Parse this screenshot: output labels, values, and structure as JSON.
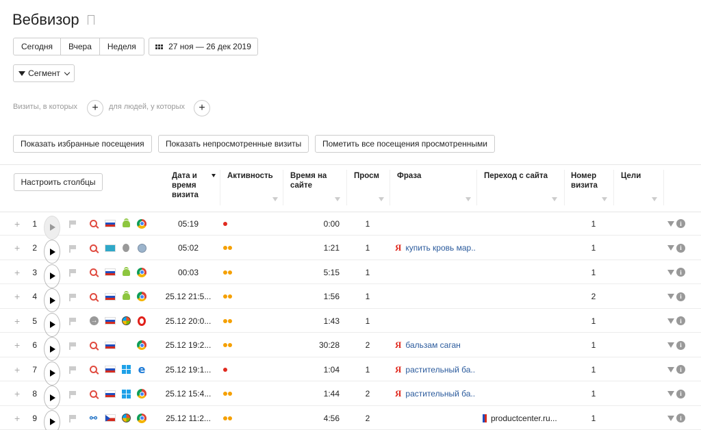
{
  "page": {
    "title": "Вебвизор"
  },
  "period": {
    "today": "Сегодня",
    "yesterday": "Вчера",
    "week": "Неделя",
    "date_range": "27 ноя — 26 дек 2019"
  },
  "segment": {
    "label": "Сегмент"
  },
  "conditions": {
    "visits_label": "Визиты, в которых",
    "people_label": "для людей, у которых"
  },
  "actions": {
    "show_favorites": "Показать избранные посещения",
    "show_unviewed": "Показать непросмотренные визиты",
    "mark_all_viewed": "Пометить все посещения просмотренными"
  },
  "table": {
    "configure_columns": "Настроить столбцы",
    "headers": {
      "datetime": "Дата и время визита",
      "activity": "Активность",
      "time_on_site": "Время на сайте",
      "views": "Просм",
      "phrase": "Фраза",
      "referrer": "Переход с сайта",
      "visit_number": "Номер визита",
      "goals": "Цели"
    },
    "rows": [
      {
        "n": "1",
        "src": "search",
        "country": "ru",
        "os": "android",
        "browser": "chrome",
        "date": "05:19",
        "activity": "red",
        "duration": "0:00",
        "views": "1",
        "phrase": "",
        "referrer": "",
        "visit": "1"
      },
      {
        "n": "2",
        "src": "search",
        "country": "kz",
        "os": "apple",
        "browser": "safari",
        "date": "05:02",
        "activity": "yellow2",
        "duration": "1:21",
        "views": "1",
        "phrase": "купить кровь мар...",
        "referrer": "",
        "visit": "1"
      },
      {
        "n": "3",
        "src": "search",
        "country": "ru",
        "os": "android",
        "browser": "chrome",
        "date": "00:03",
        "activity": "yellow2",
        "duration": "5:15",
        "views": "1",
        "phrase": "",
        "referrer": "",
        "visit": "1"
      },
      {
        "n": "4",
        "src": "search",
        "country": "ru",
        "os": "android",
        "browser": "chrome",
        "date": "25.12 21:5...",
        "activity": "yellow2",
        "duration": "1:56",
        "views": "1",
        "phrase": "",
        "referrer": "",
        "visit": "2"
      },
      {
        "n": "5",
        "src": "direct",
        "country": "ru",
        "os": "win7",
        "browser": "opera",
        "date": "25.12 20:0...",
        "activity": "yellow2",
        "duration": "1:43",
        "views": "1",
        "phrase": "",
        "referrer": "",
        "visit": "1"
      },
      {
        "n": "6",
        "src": "search",
        "country": "ru",
        "os": "",
        "browser": "chrome",
        "date": "25.12 19:2...",
        "activity": "yellow2",
        "duration": "30:28",
        "views": "2",
        "phrase": "бальзам саган",
        "referrer": "",
        "visit": "1"
      },
      {
        "n": "7",
        "src": "search",
        "country": "ru",
        "os": "windows",
        "browser": "edge",
        "date": "25.12 19:1...",
        "activity": "red",
        "duration": "1:04",
        "views": "1",
        "phrase": "растительный ба...",
        "referrer": "",
        "visit": "1"
      },
      {
        "n": "8",
        "src": "search",
        "country": "ru",
        "os": "windows",
        "browser": "chrome",
        "date": "25.12 15:4...",
        "activity": "yellow2",
        "duration": "1:44",
        "views": "2",
        "phrase": "растительный ба...",
        "referrer": "",
        "visit": "1"
      },
      {
        "n": "9",
        "src": "link",
        "country": "cz",
        "os": "win7",
        "browser": "chrome",
        "date": "25.12 11:2...",
        "activity": "yellow2",
        "duration": "4:56",
        "views": "2",
        "phrase": "",
        "referrer": "productcenter.ru...",
        "visit": "1"
      }
    ]
  },
  "icons": {
    "yandex_glyph": "Я",
    "info_glyph": "i",
    "edge_glyph": "e",
    "enter_glyph": "→",
    "link_glyph": "⚯"
  }
}
